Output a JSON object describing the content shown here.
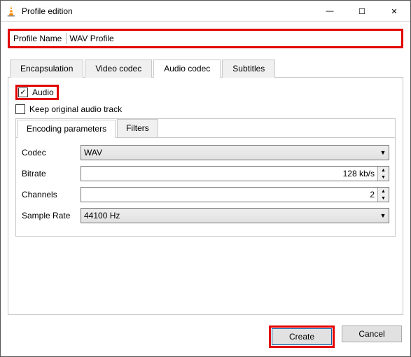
{
  "window": {
    "title": "Profile edition",
    "min": "—",
    "max": "☐",
    "close": "✕"
  },
  "profile": {
    "label": "Profile Name",
    "value": "WAV Profile"
  },
  "tabs": {
    "encapsulation": "Encapsulation",
    "video": "Video codec",
    "audio": "Audio codec",
    "subtitles": "Subtitles"
  },
  "audio_tab": {
    "audio_checkbox": "Audio",
    "keep_original": "Keep original audio track",
    "subtabs": {
      "encoding": "Encoding parameters",
      "filters": "Filters"
    },
    "fields": {
      "codec_label": "Codec",
      "codec_value": "WAV",
      "bitrate_label": "Bitrate",
      "bitrate_value": "128 kb/s",
      "channels_label": "Channels",
      "channels_value": "2",
      "samplerate_label": "Sample Rate",
      "samplerate_value": "44100 Hz"
    }
  },
  "footer": {
    "create": "Create",
    "cancel": "Cancel"
  }
}
